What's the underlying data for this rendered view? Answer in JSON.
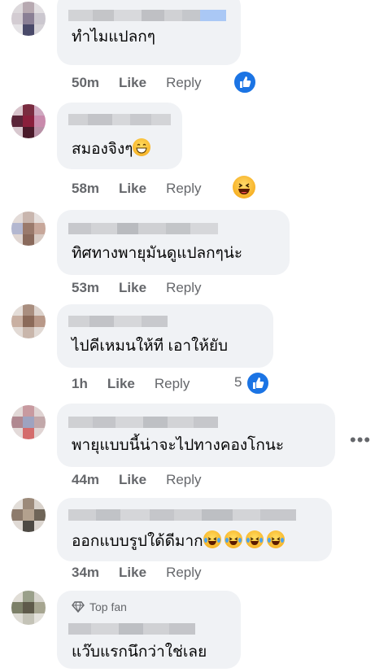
{
  "comments": [
    {
      "text": "ทำไมแปลกๆ",
      "time": "50m",
      "like": "Like",
      "reply": "Reply"
    },
    {
      "text": "สมองจิงๆ",
      "time": "58m",
      "like": "Like",
      "reply": "Reply"
    },
    {
      "text": "ทิศทางพายุมันดูแปลกๆน่ะ",
      "time": "53m",
      "like": "Like",
      "reply": "Reply"
    },
    {
      "text": "ไปคีเหมนให้ที เอาให้ยับ",
      "time": "1h",
      "like": "Like",
      "reply": "Reply",
      "reaction_count": "5"
    },
    {
      "text": "พายุแบบนี้น่าจะไปทางคองโกนะ",
      "time": "44m",
      "like": "Like",
      "reply": "Reply"
    },
    {
      "text": "ออกแบบรูปใด้ดีมาก",
      "time": "34m",
      "like": "Like",
      "reply": "Reply"
    },
    {
      "text": "แว๊บแรกนึกว่าใช่เลย",
      "badge": "Top fan"
    }
  ],
  "more_menu": "•••",
  "colors": {
    "bubble": "#f0f2f5",
    "meta_text": "#65676b",
    "like_blue": "#1b74e4"
  },
  "icons": [
    "like-reaction-icon",
    "haha-reaction-icon",
    "grin-emoji-icon",
    "laugh-cry-emoji-icon",
    "diamond-icon",
    "more-icon"
  ]
}
